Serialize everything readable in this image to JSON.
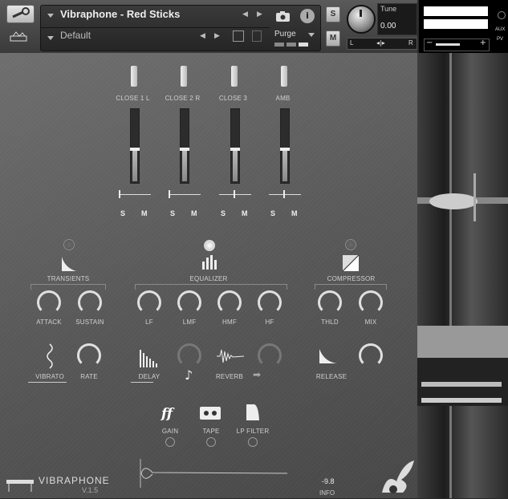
{
  "header": {
    "instrument_name": "Vibraphone - Red Sticks",
    "preset_name": "Default",
    "purge_label": "Purge",
    "solo_label": "S",
    "mute_label": "M",
    "tune_label": "Tune",
    "tune_value": "0.00",
    "pan_left": "L",
    "pan_right": "R",
    "aux_label": "AUX",
    "pv_label": "PV"
  },
  "mic_channels": [
    {
      "label": "CLOSE 1 L",
      "level": 0.45
    },
    {
      "label": "CLOSE 2 R",
      "level": 0.45
    },
    {
      "label": "CLOSE 3",
      "level": 0.45
    },
    {
      "label": "AMB",
      "level": 0.45
    }
  ],
  "channel_buttons": {
    "solo": "S",
    "mute": "M"
  },
  "sections": {
    "transients": "TRANSIENTS",
    "equalizer": "EQUALIZER",
    "compressor": "COMPRESSOR"
  },
  "knobs": {
    "attack": "ATTACK",
    "sustain": "SUSTAIN",
    "lf": "LF",
    "lmf": "LMF",
    "hmf": "HMF",
    "hf": "HF",
    "thld": "THLD",
    "mix": "MIX",
    "vibrato": "VIBRATO",
    "rate": "RATE",
    "delay": "DELAY",
    "reverb": "REVERB",
    "release": "RELEASE"
  },
  "bottom": {
    "gain": "GAIN",
    "tape": "TAPE",
    "lp_filter": "LP FILTER",
    "logo": "VIBRAPHONE",
    "version": "V.1.5",
    "level_value": "-9.8",
    "info": "INFO",
    "gain_icon_text": "ff"
  }
}
